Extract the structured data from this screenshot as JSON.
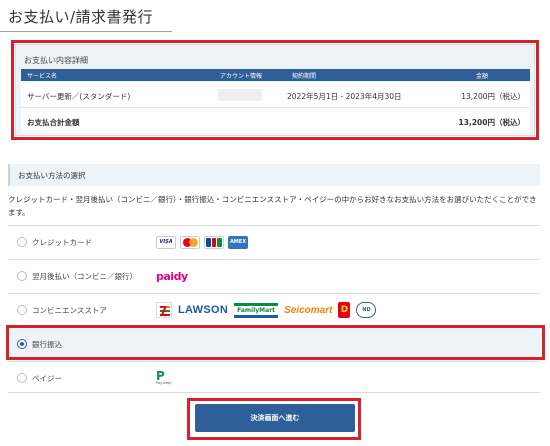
{
  "page": {
    "title": "お支払い/請求書発行"
  },
  "details": {
    "title": "お支払い内容詳細",
    "columns": [
      "サービス名",
      "アカウント情報",
      "契約期間",
      "金額"
    ],
    "rows": [
      {
        "service": "サーバー更新／(スタンダード)",
        "account": "",
        "period": "2022年5月1日 - 2023年4月30日",
        "amount": "13,200円（税込）"
      }
    ],
    "total": {
      "label": "お支払合計金額",
      "amount": "13,200円（税込）"
    }
  },
  "method": {
    "header": "お支払い方法の選択",
    "description": "クレジットカード・翌月後払い（コンビニ／銀行）・銀行振込・コンビニエンスストア・ペイジーの中からお好きなお支払い方法をお選びいただくことができます。",
    "options": [
      {
        "label": "クレジットカード",
        "selected": false,
        "logos": [
          "visa-logo",
          "mastercard-logo",
          "jcb-logo",
          "amex-logo"
        ]
      },
      {
        "label": "翌月後払い（コンビニ／銀行）",
        "selected": false,
        "logos": [
          "paidy-logo"
        ]
      },
      {
        "label": "コンビニエンスストア",
        "selected": false,
        "logos": [
          "seven-eleven-logo",
          "lawson-logo",
          "familymart-logo",
          "seicomart-logo",
          "daily-yamazaki-logo",
          "newdays-logo"
        ]
      },
      {
        "label": "銀行振込",
        "selected": true,
        "logos": []
      },
      {
        "label": "ペイジー",
        "selected": false,
        "logos": [
          "payeasy-logo"
        ]
      }
    ]
  },
  "logos": {
    "visa": "VISA",
    "amex": "AMEX",
    "paidy": "paidy",
    "lawson": "LAWSON",
    "familymart": "FamilyMart",
    "seicomart": "Seicomart",
    "payeasy_sub": "Pay-easy"
  },
  "submit": {
    "label": "決済画面へ進む"
  },
  "colors": {
    "accent": "#2f5f98",
    "highlight": "#d6222a",
    "panel": "#eef3f8"
  }
}
